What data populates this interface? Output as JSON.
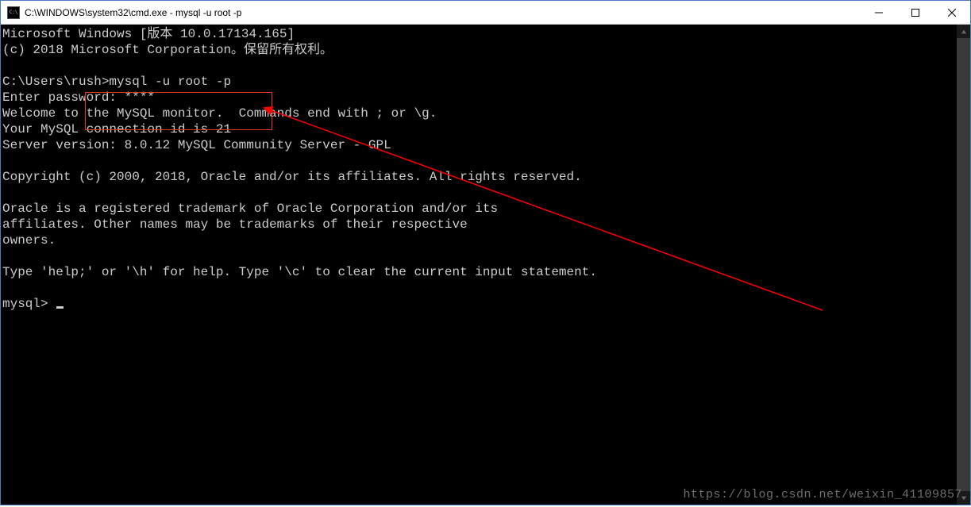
{
  "window": {
    "title": "C:\\WINDOWS\\system32\\cmd.exe - mysql  -u root -p"
  },
  "terminal": {
    "lines": [
      "Microsoft Windows [版本 10.0.17134.165]",
      "(c) 2018 Microsoft Corporation。保留所有权利。",
      "",
      "C:\\Users\\rush>mysql -u root -p",
      "Enter password: ****",
      "Welcome to the MySQL monitor.  Commands end with ; or \\g.",
      "Your MySQL connection id is 21",
      "Server version: 8.0.12 MySQL Community Server - GPL",
      "",
      "Copyright (c) 2000, 2018, Oracle and/or its affiliates. All rights reserved.",
      "",
      "Oracle is a registered trademark of Oracle Corporation and/or its",
      "affiliates. Other names may be trademarks of their respective",
      "owners.",
      "",
      "Type 'help;' or '\\h' for help. Type '\\c' to clear the current input statement.",
      "",
      "mysql> "
    ],
    "prompt": "mysql> "
  },
  "watermark": "https://blog.csdn.net/weixin_41109857"
}
